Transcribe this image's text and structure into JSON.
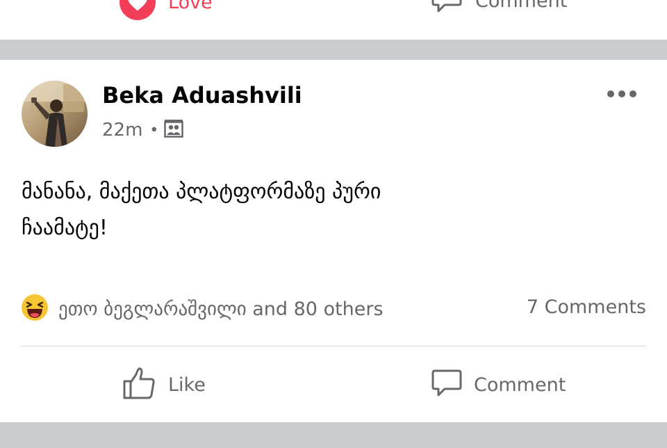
{
  "previous_post": {
    "love_label": "Love",
    "comment_label": "Comment"
  },
  "post": {
    "author": "Beka Aduashvili",
    "time": "22m",
    "separator": "•",
    "privacy_icon": "friends-album-icon",
    "text_line1": "მანანა, მაქეთა პლატფორმაზე პური",
    "text_line2": "ჩაამატე!",
    "reaction_icon": "haha-icon",
    "reactions_summary": "ეთო ბეგლარაშვილი and 80 others",
    "comments_count": "7 Comments",
    "like_label": "Like",
    "comment_label": "Comment"
  },
  "colors": {
    "love": "#f33e58",
    "secondary_text": "#65676b",
    "separator": "#c9ccd1"
  }
}
